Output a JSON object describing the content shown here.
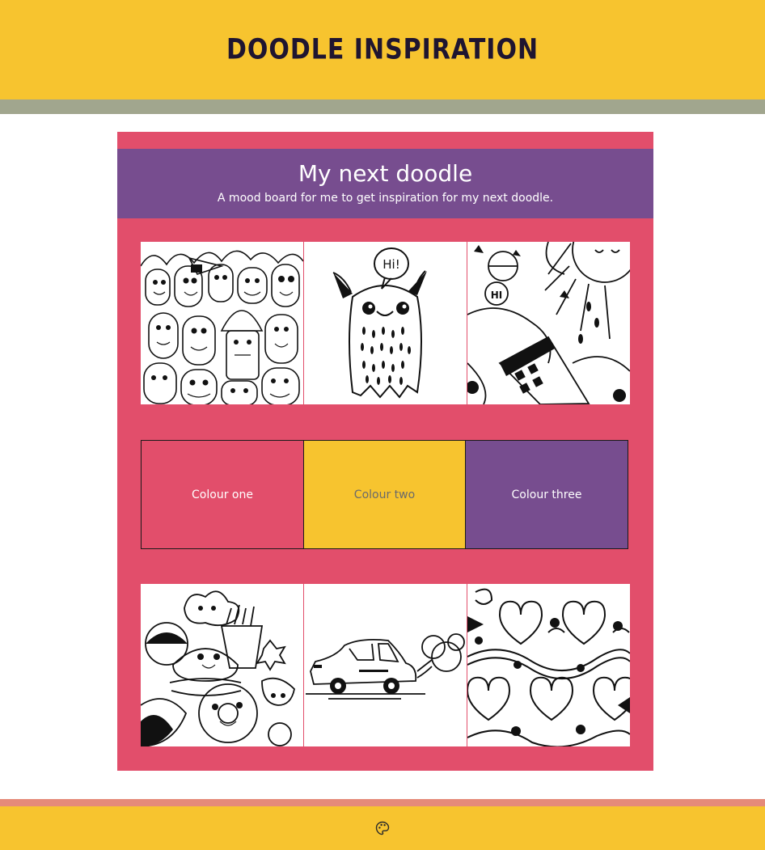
{
  "header": {
    "title": "Doodle Inspiration"
  },
  "board": {
    "title": "My next doodle",
    "subtitle": "A mood board for me to get inspiration for my next doodle."
  },
  "images_top": [
    {
      "icon": "monster-crowd-doodle"
    },
    {
      "icon": "hi-monster-doodle",
      "speech": "Hi!"
    },
    {
      "icon": "sun-phone-doodle",
      "speech": "HI"
    }
  ],
  "swatches": [
    {
      "label": "Colour one",
      "color": "#e24e6b"
    },
    {
      "label": "Colour two",
      "color": "#f7c42f"
    },
    {
      "label": "Colour three",
      "color": "#774d8f"
    }
  ],
  "images_bottom": [
    {
      "icon": "food-characters-doodle"
    },
    {
      "icon": "car-doodle"
    },
    {
      "icon": "heart-pattern-doodle"
    }
  ],
  "footer": {
    "icon": "palette-icon"
  },
  "colors": {
    "header": "#f7c42f",
    "header_stripe": "#a1a68e",
    "board": "#e24e6b",
    "banner": "#774d8f",
    "footer_stripe": "#e58a7a"
  }
}
